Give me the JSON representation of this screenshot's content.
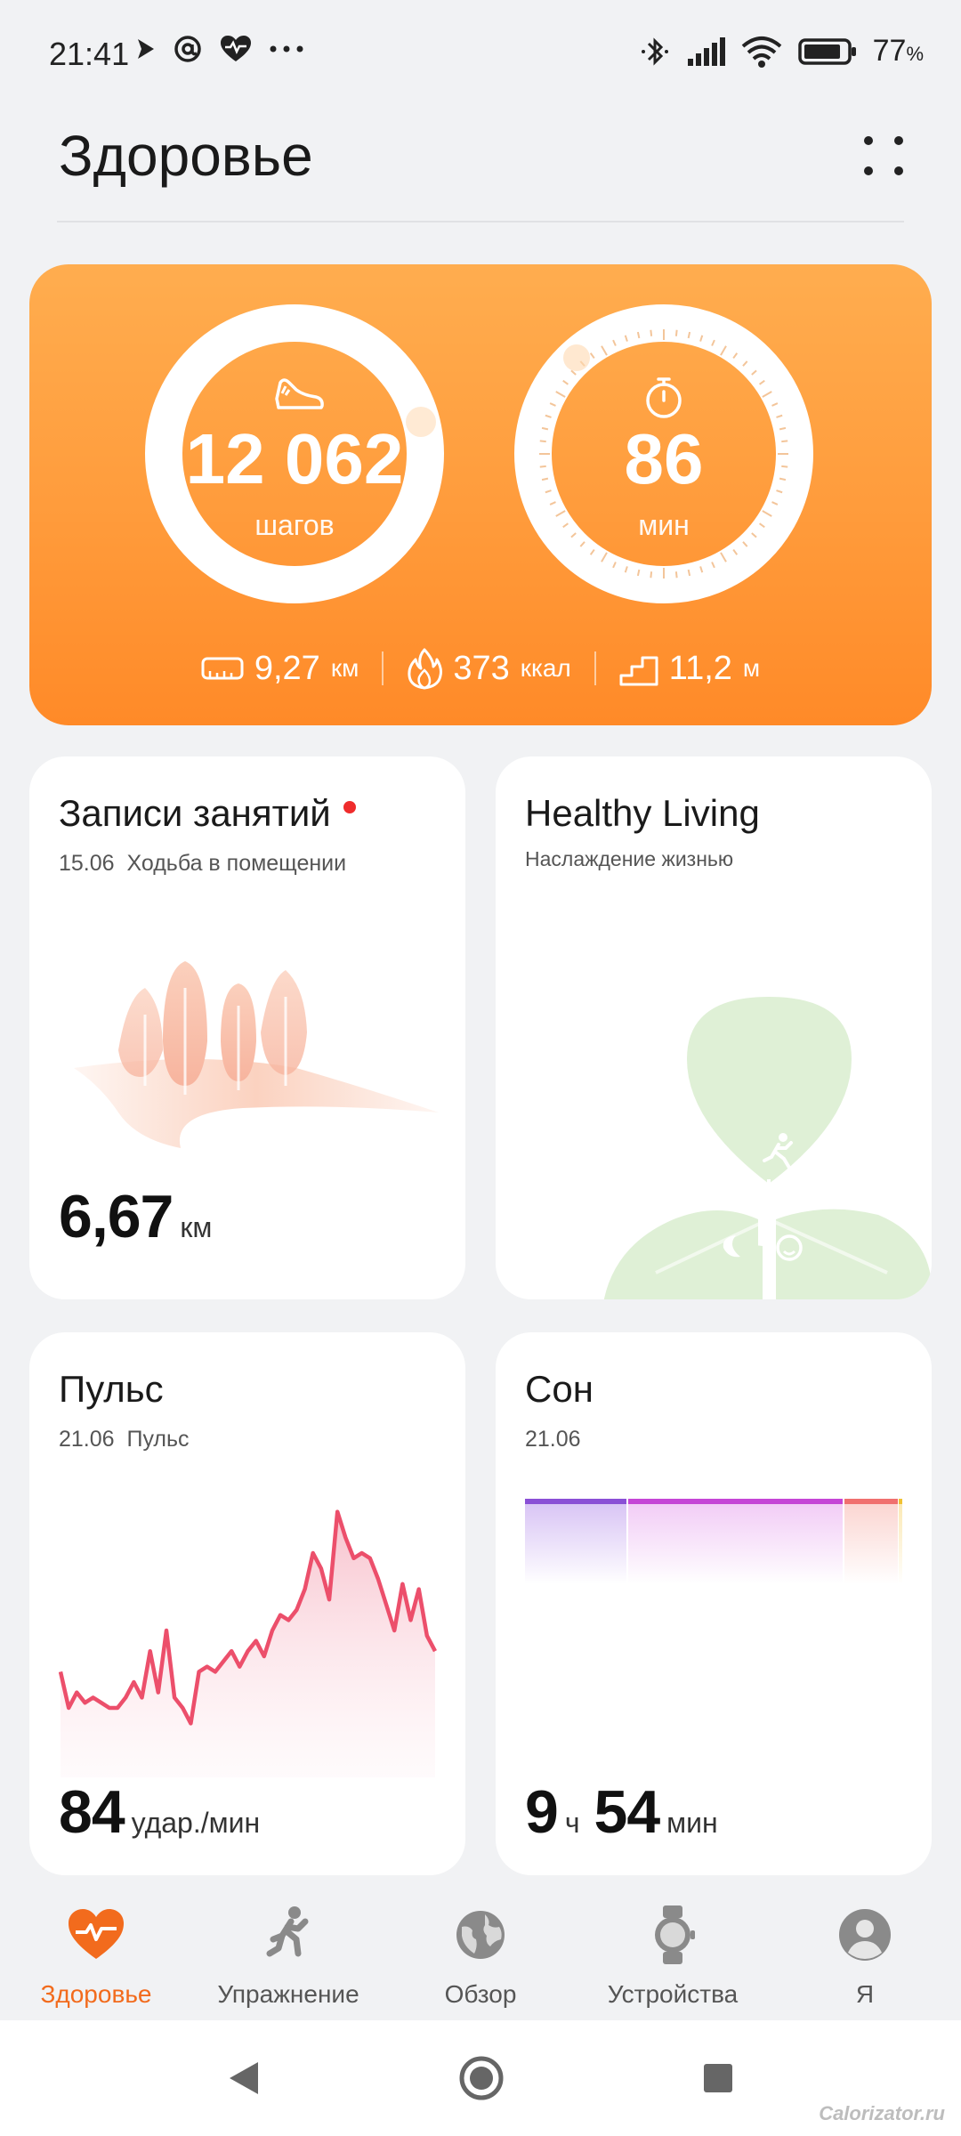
{
  "status_bar": {
    "time": "21:41",
    "battery": "77",
    "battery_unit": "%",
    "icons_left": [
      "play-icon",
      "at-icon",
      "heart-rate-icon",
      "more-icon"
    ],
    "icons_right": [
      "bluetooth-icon",
      "signal-icon",
      "wifi-icon",
      "battery-icon"
    ]
  },
  "header": {
    "title": "Здоровье"
  },
  "activity": {
    "steps": {
      "value": "12 062",
      "unit": "шагов",
      "progress": 1.0
    },
    "minutes": {
      "value": "86",
      "unit": "мин"
    },
    "distance": {
      "value": "9,27",
      "unit": "км"
    },
    "calories": {
      "value": "373",
      "unit": "ккал"
    },
    "floors": {
      "value": "11,2",
      "unit": "м"
    }
  },
  "workouts": {
    "title": "Записи занятий",
    "date": "15.06",
    "type": "Ходьба в помещении",
    "value": "6,67",
    "unit": "км"
  },
  "healthy_living": {
    "title": "Healthy Living",
    "subtitle": "Наслаждение жизнью"
  },
  "pulse": {
    "title": "Пульс",
    "date": "21.06",
    "label": "Пульс",
    "value": "84",
    "unit": "удар./мин",
    "series": [
      62,
      55,
      58,
      56,
      57,
      56,
      55,
      55,
      57,
      60,
      57,
      66,
      58,
      70,
      57,
      55,
      52,
      62,
      63,
      62,
      64,
      66,
      63,
      66,
      68,
      65,
      70,
      73,
      72,
      74,
      78,
      85,
      82,
      76,
      93,
      88,
      84,
      85,
      84,
      80,
      75,
      70,
      79,
      72,
      78,
      69,
      66
    ]
  },
  "sleep": {
    "title": "Сон",
    "date": "21.06",
    "hours": "9",
    "hours_unit": "ч",
    "minutes": "54",
    "minutes_unit": "мин"
  },
  "bottom_nav": [
    {
      "label": "Здоровье",
      "icon": "health-heart-icon",
      "active": true
    },
    {
      "label": "Упражнение",
      "icon": "running-icon",
      "active": false
    },
    {
      "label": "Обзор",
      "icon": "globe-icon",
      "active": false
    },
    {
      "label": "Устройства",
      "icon": "watch-icon",
      "active": false
    },
    {
      "label": "Я",
      "icon": "profile-icon",
      "active": false
    }
  ],
  "system_nav": [
    "back-icon",
    "home-icon",
    "recents-icon"
  ],
  "watermark": "Calorizator.ru",
  "colors": {
    "accent": "#f26b1d",
    "card_orange": "#ff9d3e",
    "pulse_line": "#ec4f6b",
    "sleep_deep": "#8a4fd6",
    "sleep_light": "#c545d6",
    "sleep_rem": "#f0706f",
    "sleep_awake": "#f1c232"
  }
}
